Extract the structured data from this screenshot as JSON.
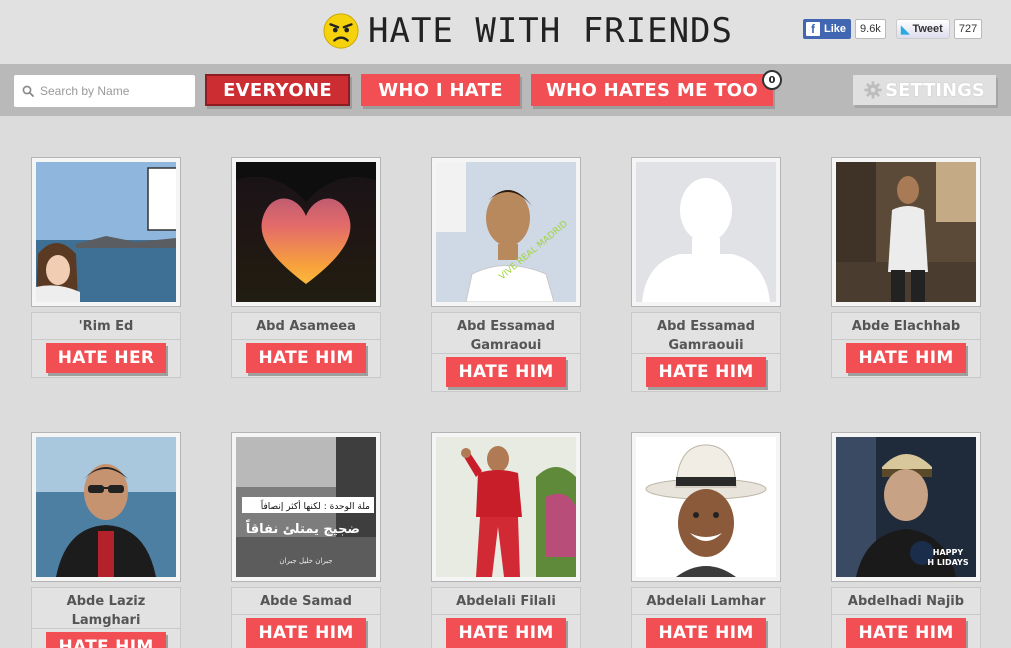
{
  "header": {
    "title": "HATE WITH FRIENDS",
    "fb": {
      "label": "Like",
      "count": "9.6k"
    },
    "tw": {
      "label": "Tweet",
      "count": "727"
    }
  },
  "nav": {
    "search_placeholder": "Search by Name",
    "tabs": [
      {
        "label": "EVERYONE",
        "active": true
      },
      {
        "label": "WHO I HATE",
        "active": false
      },
      {
        "label": "WHO HATES ME TOO",
        "active": false
      }
    ],
    "badge": "0",
    "settings_label": "SETTINGS"
  },
  "colors": {
    "accent": "#f24f55",
    "accent_active": "#cc2d33",
    "navbar": "#b9b9b9",
    "background": "#dcdcdc"
  },
  "people": [
    {
      "name": "'Rim Ed",
      "action": "HATE HER"
    },
    {
      "name": "Abd Asameea",
      "action": "HATE HIM"
    },
    {
      "name": "Abd Essamad Gamraoui",
      "action": "HATE HIM"
    },
    {
      "name": "Abd Essamad Gamraouii",
      "action": "HATE HIM"
    },
    {
      "name": "Abde Elachhab",
      "action": "HATE HIM"
    },
    {
      "name": "Abde Laziz Lamghari",
      "action": "HATE HIM"
    },
    {
      "name": "Abde Samad",
      "action": "HATE HIM"
    },
    {
      "name": "Abdelali Filali",
      "action": "HATE HIM"
    },
    {
      "name": "Abdelali Lamhar",
      "action": "HATE HIM"
    },
    {
      "name": "Abdelhadi Najib",
      "action": "HATE HIM"
    }
  ],
  "photo_texts": {
    "p2_caption": "VIVE REAL MADRID",
    "p6_line1": "ملة الوحدة : لكنها أكثر إنصافاً",
    "p6_line2": "ضجيج يمتلئ نفاقاً",
    "p6_credit": "جبران خليل جبران",
    "p9_line1": "HAPPY",
    "p9_line2": "H LIDAYS"
  }
}
